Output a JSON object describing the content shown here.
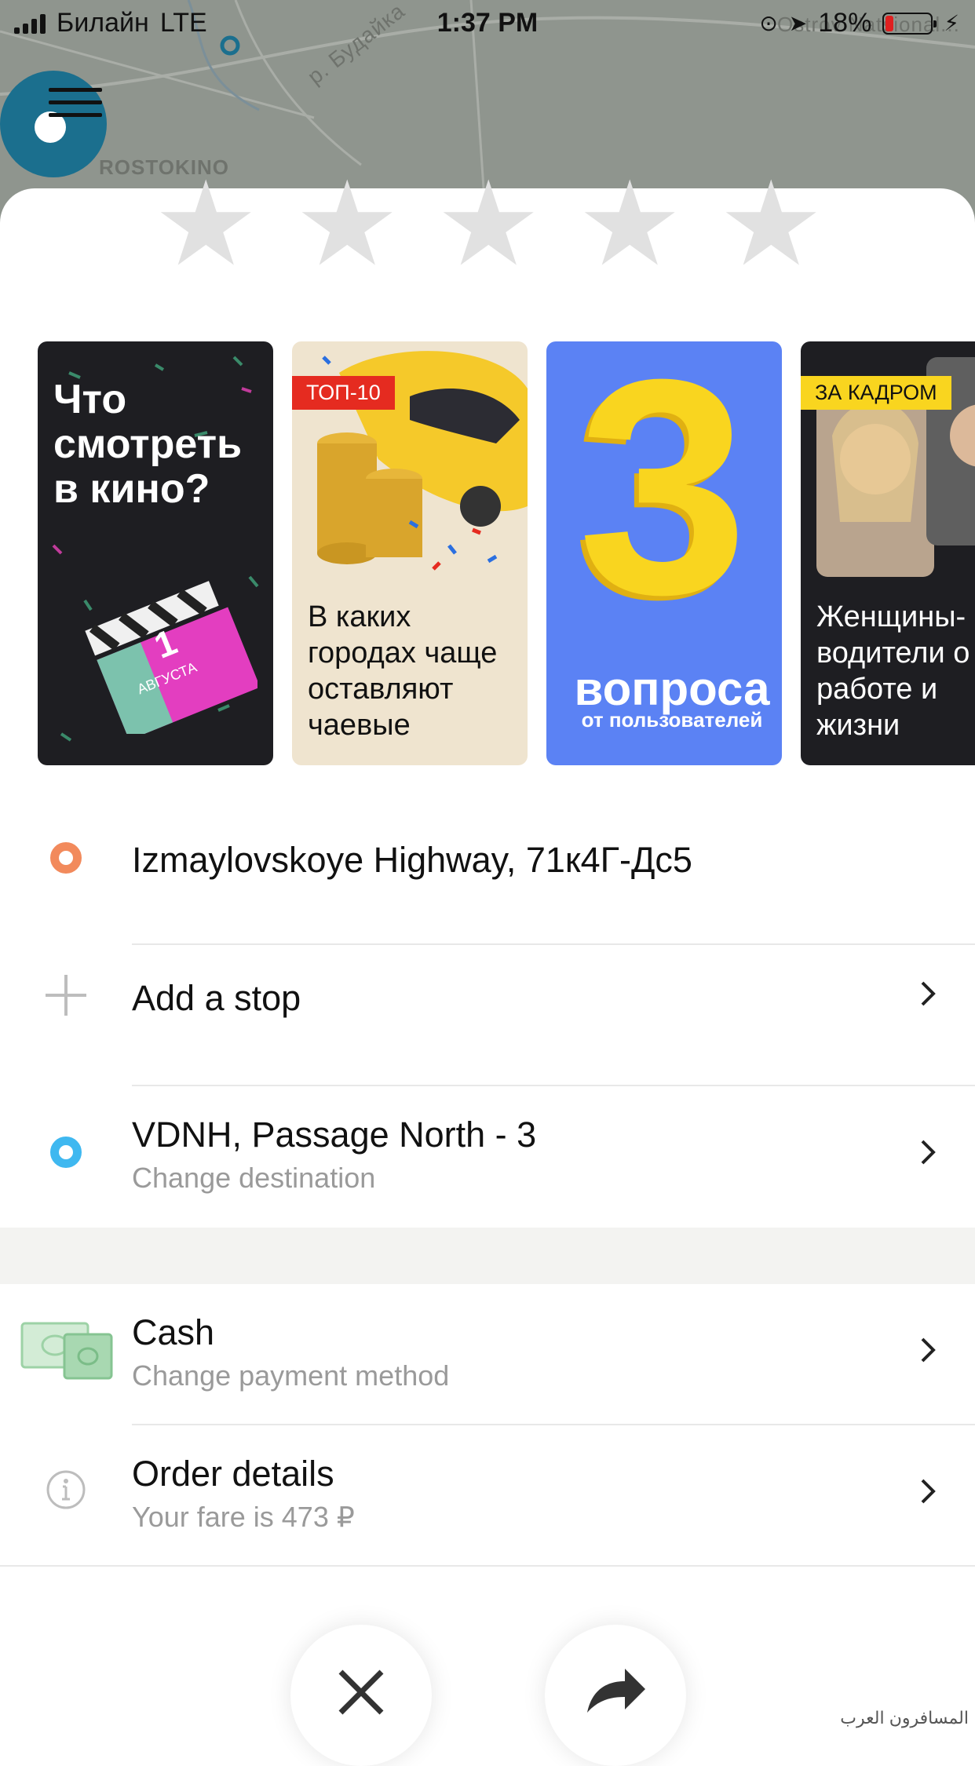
{
  "status_bar": {
    "carrier": "Билайн",
    "network": "LTE",
    "time": "1:37 PM",
    "battery": "18%",
    "battery_level": 0.18
  },
  "map": {
    "label_district": "ROSTOKINO",
    "label_river": "р. Будайка",
    "label_park": "Ostrov Natsional..."
  },
  "menu": {
    "icon": "hamburger-icon"
  },
  "rating": {
    "stars": 5
  },
  "stories": [
    {
      "title": "Что смотреть в кино?",
      "date_number": "1",
      "date_month": "АВГУСТА",
      "bg": "#1e1e22"
    },
    {
      "badge": "ТОП-10",
      "caption": "В каких городах чаще оставляют чаевые",
      "bg": "#efe4cf"
    },
    {
      "big": "3",
      "title": "вопроса",
      "subtitle": "от пользователей",
      "bg": "#5b82f4"
    },
    {
      "badge": "ЗА КАДРОМ",
      "caption": "Женщины-водители о работе и жизни",
      "bg": "#1e1e22"
    }
  ],
  "route": {
    "from": "Izmaylovskoye Highway, 71к4Г-Дс5",
    "add_stop": "Add a stop",
    "to": "VDNH, Passage North - 3",
    "to_hint": "Change destination"
  },
  "payment": {
    "method": "Cash",
    "hint": "Change payment method"
  },
  "order": {
    "title": "Order details",
    "fare": "Your fare is 473 ₽"
  },
  "colors": {
    "from_dot": "#f28a5c",
    "to_dot": "#3fb8f0",
    "menu_button": "#1b6f8e"
  },
  "watermark": "المسافرون العرب"
}
